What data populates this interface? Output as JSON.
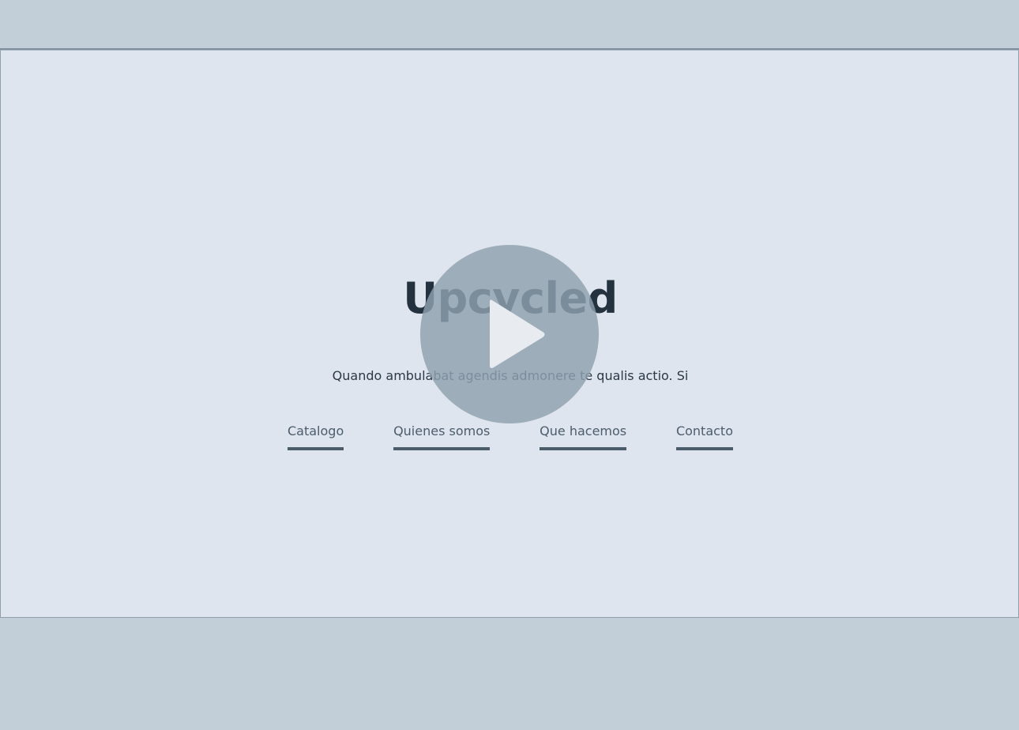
{
  "hero": {
    "title": "Upcycled",
    "subtitle": "Quando ambulabat agendis admonere te qualis actio. Si"
  },
  "nav": {
    "items": [
      {
        "label": "Catalogo"
      },
      {
        "label": "Quienes somos"
      },
      {
        "label": "Que hacemos"
      },
      {
        "label": "Contacto"
      }
    ]
  },
  "video": {
    "icon": "play-icon"
  },
  "colors": {
    "page_background": "#c2ced8",
    "hero_background": "#dfe5ee",
    "title": "#24323f",
    "link": "#4b5c6b",
    "play_overlay": "#8fa0ae"
  }
}
